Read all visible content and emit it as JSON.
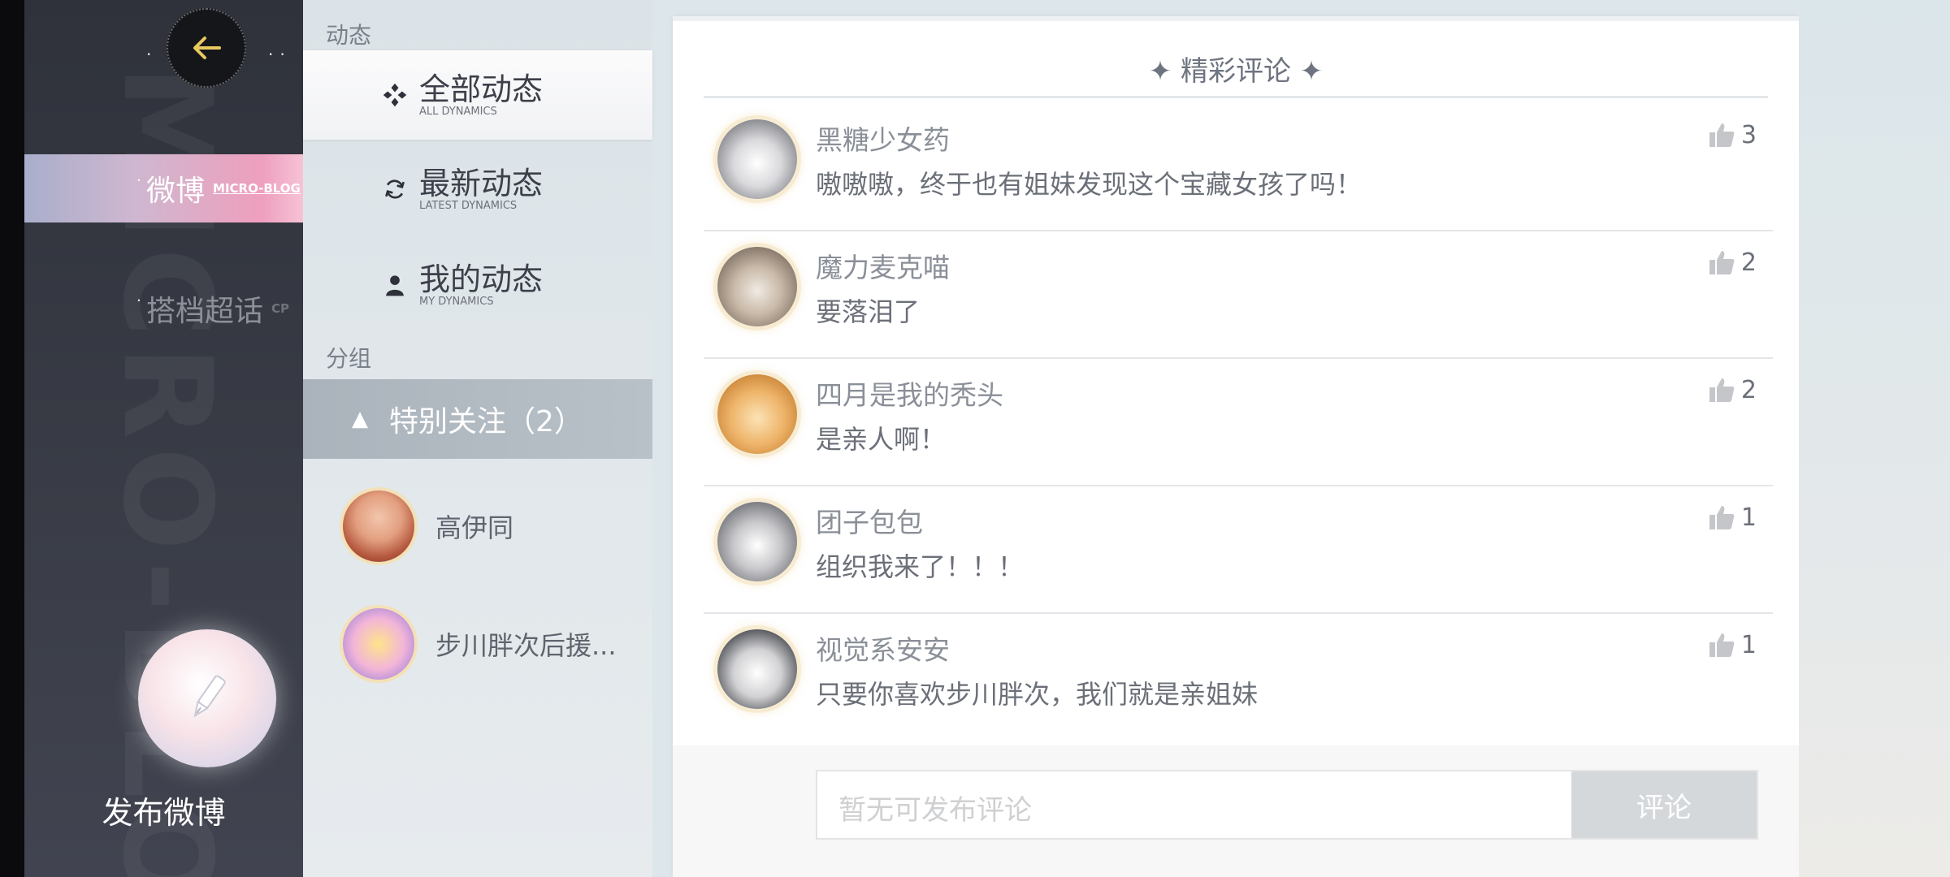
{
  "sidebar": {
    "watermark": "MICRO-BLOG",
    "items": [
      {
        "label": "微博",
        "sublabel": "MICRO-BLOG",
        "active": true
      },
      {
        "label": "搭档超话",
        "sublabel": "CP",
        "active": false
      }
    ],
    "publish_label": "发布微博"
  },
  "menu": {
    "section_dynamics": "动态",
    "dynamics": [
      {
        "label": "全部动态",
        "sublabel": "ALL DYNAMICS",
        "icon": "four-diamonds-icon"
      },
      {
        "label": "最新动态",
        "sublabel": "LATEST DYNAMICS",
        "icon": "refresh-icon"
      },
      {
        "label": "我的动态",
        "sublabel": "MY DYNAMICS",
        "icon": "person-icon"
      }
    ],
    "section_groups": "分组",
    "group": {
      "label": "特别关注（2）",
      "icon": "triangle-up-icon"
    },
    "friends": [
      {
        "name": "高伊同"
      },
      {
        "name": "步川胖次后援..."
      }
    ]
  },
  "panel": {
    "title": "✦ 精彩评论 ✦",
    "comments": [
      {
        "user": "黑糖少女药",
        "text": "嗷嗷嗷，终于也有姐妹发现这个宝藏女孩了吗！",
        "likes": "3"
      },
      {
        "user": "魔力麦克喵",
        "text": "要落泪了",
        "likes": "2"
      },
      {
        "user": "四月是我的秃头",
        "text": "是亲人啊！",
        "likes": "2"
      },
      {
        "user": "团子包包",
        "text": "组织我来了！！！",
        "likes": "1"
      },
      {
        "user": "视觉系安安",
        "text": "只要你喜欢步川胖次，我们就是亲姐妹",
        "likes": "1"
      }
    ],
    "input_placeholder": "暂无可发布评论",
    "submit_label": "评论"
  },
  "colors": {
    "accent_pink": "#ee9fbd",
    "rail_dark": "#2f323b",
    "avatar_ring": "#f7ecd2"
  }
}
